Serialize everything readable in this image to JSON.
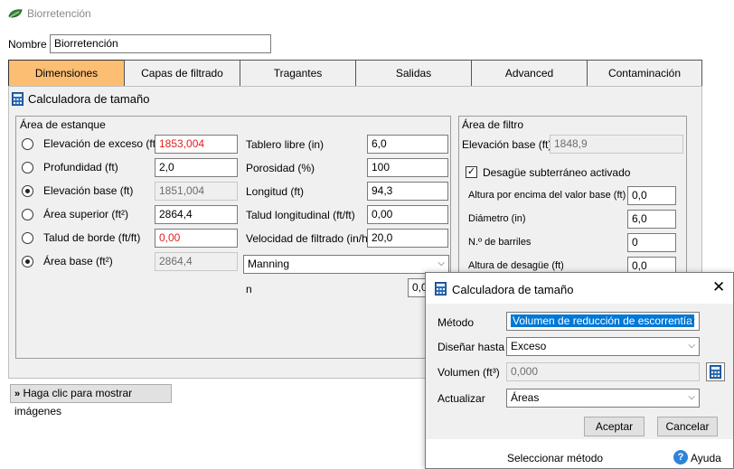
{
  "window": {
    "title": "Biorretención",
    "logo_icon": "leaf-icon"
  },
  "name_field": {
    "label": "Nombre",
    "value": "Biorretención"
  },
  "tabs": [
    {
      "label": "Dimensiones",
      "active": true
    },
    {
      "label": "Capas de filtrado",
      "active": false
    },
    {
      "label": "Tragantes",
      "active": false
    },
    {
      "label": "Salidas",
      "active": false
    },
    {
      "label": "Advanced",
      "active": false
    },
    {
      "label": "Contaminación",
      "active": false
    }
  ],
  "calculator_link": "Calculadora de tamaño",
  "pond_area": {
    "title": "Área de estanque",
    "rows": [
      {
        "label": "Elevación de exceso (ft)",
        "value": "1853,004",
        "selected": false
      },
      {
        "label": "Profundidad (ft)",
        "value": "2,0",
        "selected": false
      },
      {
        "label": "Elevación base (ft)",
        "value": "1851,004",
        "selected": true
      },
      {
        "label": "Área superior (ft²)",
        "value": "2864,4",
        "selected": false
      },
      {
        "label": "Talud de borde (ft/ft)",
        "value": "0,00",
        "selected": false
      },
      {
        "label": "Área base (ft²)",
        "value": "2864,4",
        "selected": true
      }
    ],
    "right_rows": [
      {
        "label": "Tablero libre (in)",
        "value": "6,0"
      },
      {
        "label": "Porosidad (%)",
        "value": "100"
      },
      {
        "label": "Longitud (ft)",
        "value": "94,3"
      },
      {
        "label": "Talud longitudinal (ft/ft)",
        "value": "0,00"
      },
      {
        "label": "Velocidad de filtrado (in/h)",
        "value": "20,0"
      }
    ],
    "method_combo": "Manning",
    "n_label": "n",
    "n_value": "0,0"
  },
  "filter_area": {
    "title": "Área de filtro",
    "base_label": "Elevación base (ft)",
    "base_value": "1848,9",
    "underdrain_label": "Desagüe subterráneo activado",
    "underdrain_checked": true,
    "rows": [
      {
        "label": "Altura por encima del valor base (ft)",
        "value": "0,0"
      },
      {
        "label": "Diámetro (in)",
        "value": "6,0"
      },
      {
        "label": "N.º de barriles",
        "value": "0"
      },
      {
        "label": "Altura de desagüe (ft)",
        "value": "0,0"
      }
    ]
  },
  "show_images_button": "Haga clic para mostrar imágenes",
  "dialog": {
    "title": "Calculadora de tamaño",
    "method_label": "Método",
    "method_value": "Volumen de reducción de escorrentía",
    "design_label": "Diseñar hasta",
    "design_value": "Exceso",
    "volume_label": "Volumen (ft³)",
    "volume_value": "0,000",
    "update_label": "Actualizar",
    "update_value": "Áreas",
    "accept_button": "Aceptar",
    "cancel_button": "Cancelar",
    "status_text": "Seleccionar método",
    "help_text": "Ayuda"
  },
  "colors": {
    "active_tab": "#fbbe73",
    "error_text": "#e22020",
    "selection": "#0078d7"
  }
}
